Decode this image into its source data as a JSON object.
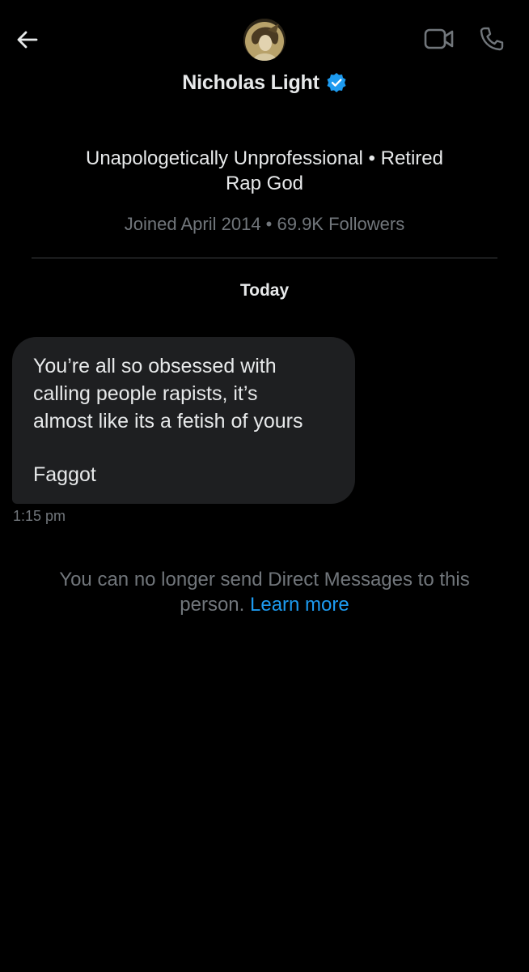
{
  "header": {
    "name": "Nicholas Light",
    "back_icon": "arrow-left-icon",
    "video_icon": "video-camera-icon",
    "call_icon": "phone-icon",
    "verified_icon": "verified-badge-icon",
    "verified_color": "#1d9bf0"
  },
  "profile": {
    "bio_line1": "Unapologetically Unprofessional • Retired",
    "bio_line2": "Rap God",
    "meta": "Joined April 2014 • 69.9K Followers"
  },
  "conversation": {
    "day_label": "Today",
    "messages": [
      {
        "lines": [
          "You’re all so obsessed with",
          "calling people rapists, it’s",
          "almost like its a fetish of yours"
        ],
        "last_line": "Faggot",
        "time": "1:15 pm"
      }
    ]
  },
  "notice": {
    "text": "You can no longer send Direct Messages to this person.",
    "link": "Learn more",
    "link_color": "#1d9bf0"
  },
  "colors": {
    "background": "#000000",
    "bubble": "#1e1f21",
    "primary_text": "#e7e9ea",
    "secondary_text": "#71767b"
  }
}
